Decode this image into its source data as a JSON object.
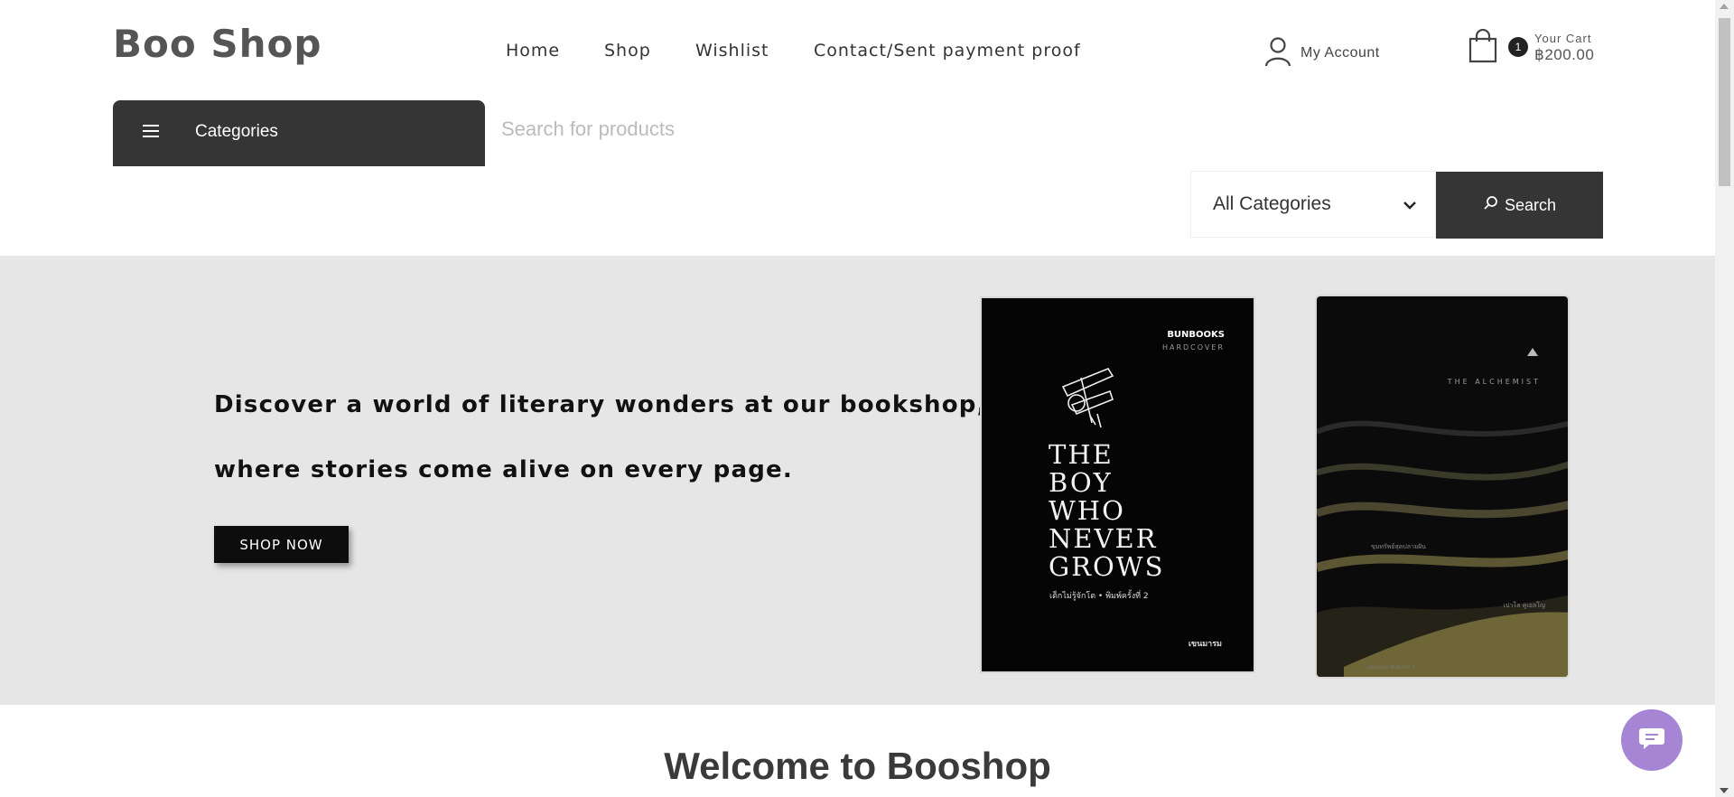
{
  "header": {
    "logo": "Boo Shop",
    "nav": [
      "Home",
      "Shop",
      "Wishlist",
      "Contact/Sent payment proof"
    ],
    "account_label": "My Account",
    "cart": {
      "count": "1",
      "label": "Your Cart",
      "total": "฿200.00"
    }
  },
  "search": {
    "categories_label": "Categories",
    "placeholder": "Search for products",
    "category_select": "All Categories",
    "button_label": "Search"
  },
  "hero": {
    "line1": "Discover a world of literary wonders at our bookshop,",
    "line2": "where stories come alive on every page.",
    "cta_label": "SHOP NOW",
    "book1": {
      "publisher": "BUNBOOKS",
      "edition": "HARDCOVER",
      "title_lines": [
        "THE",
        "BOY",
        "WHO",
        "NEVER",
        "GROWS"
      ],
      "subtitle": "เด็กไม่รู้จักโต • พิมพ์ครั้งที่ 2",
      "author": "เขนมารม"
    },
    "book2": {
      "title": "THE ALCHEMIST",
      "subtitle": "ขุมทรัพย์สุดปลายฝัน",
      "author": "เปาโล คูเอลโญ",
      "footer": "ฉบับปกแข็ง พิมพ์ครั้งที่ 2"
    }
  },
  "welcome_title": "Welcome to Booshop",
  "colors": {
    "dark": "#353535",
    "hero_bg": "#e6e6e6",
    "chat_bg": "#a685d4"
  }
}
